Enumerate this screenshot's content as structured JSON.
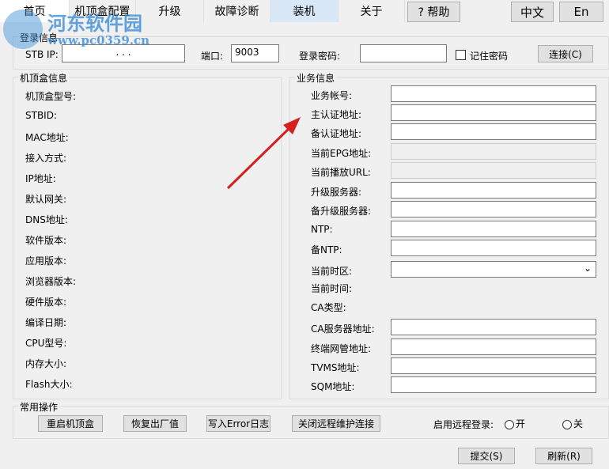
{
  "tabs": [
    "首页",
    "机顶盒配置",
    "升级",
    "故障诊断",
    "装机",
    "关于"
  ],
  "help_label": "? 帮助",
  "lang": {
    "zh": "中文",
    "en": "En"
  },
  "login": {
    "title": "登录信息",
    "stb_ip_label": "STB IP:",
    "stb_ip_value": ".       .       .",
    "port_label": "端口:",
    "port_value": "9003",
    "password_label": "登录密码:",
    "password_value": "",
    "remember_label": "记住密码",
    "connect_label": "连接(C)"
  },
  "stb_info": {
    "title": "机顶盒信息",
    "labels": [
      "机顶盒型号:",
      "STBID:",
      "MAC地址:",
      "接入方式:",
      "IP地址:",
      "默认网关:",
      "DNS地址:",
      "软件版本:",
      "应用版本:",
      "浏览器版本:",
      "硬件版本:",
      "编译日期:",
      "CPU型号:",
      "内存大小:",
      "Flash大小:"
    ]
  },
  "service": {
    "title": "业务信息",
    "fields": [
      {
        "label": "业务帐号:",
        "type": "input",
        "value": ""
      },
      {
        "label": "主认证地址:",
        "type": "input",
        "value": ""
      },
      {
        "label": "备认证地址:",
        "type": "input",
        "value": ""
      },
      {
        "label": "当前EPG地址:",
        "type": "readonly",
        "value": ""
      },
      {
        "label": "当前播放URL:",
        "type": "readonly",
        "value": ""
      },
      {
        "label": "升级服务器:",
        "type": "input",
        "value": ""
      },
      {
        "label": "备升级服务器:",
        "type": "input",
        "value": ""
      },
      {
        "label": "NTP:",
        "type": "input",
        "value": ""
      },
      {
        "label": "备NTP:",
        "type": "input",
        "value": ""
      },
      {
        "label": "当前时区:",
        "type": "select",
        "value": ""
      },
      {
        "label": "当前时间:",
        "type": "none",
        "value": ""
      },
      {
        "label": "CA类型:",
        "type": "none",
        "value": ""
      },
      {
        "label": "CA服务器地址:",
        "type": "input",
        "value": ""
      },
      {
        "label": "终端网管地址:",
        "type": "input",
        "value": ""
      },
      {
        "label": "TVMS地址:",
        "type": "input",
        "value": ""
      },
      {
        "label": "SQM地址:",
        "type": "input",
        "value": ""
      }
    ]
  },
  "ops": {
    "title": "常用操作",
    "buttons": [
      "重启机顶盒",
      "恢复出厂值",
      "写入Error日志",
      "关闭远程维护连接"
    ],
    "remote_label": "启用远程登录:",
    "on": "开",
    "off": "关"
  },
  "footer": {
    "submit": "提交(S)",
    "refresh": "刷新(R)"
  },
  "watermark": {
    "name": "河东软件园",
    "url": "www.pc0359.cn"
  },
  "colors": {
    "arrow": "#d42020",
    "tab_highlight": "#d9e8f7"
  }
}
